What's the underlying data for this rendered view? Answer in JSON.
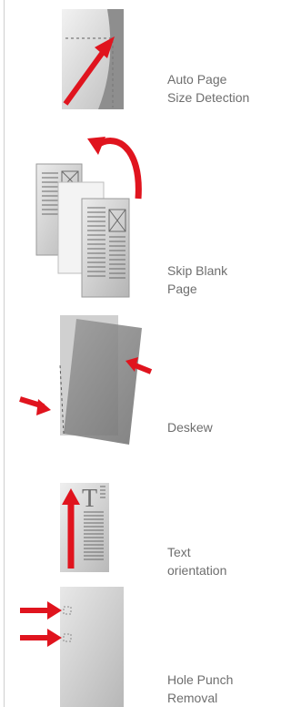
{
  "features": [
    {
      "line1": "Auto Page",
      "line2": "Size Detection",
      "icon": "auto-page-size-detection-icon"
    },
    {
      "line1": "Skip Blank",
      "line2": "Page",
      "icon": "skip-blank-page-icon"
    },
    {
      "line1": "Deskew",
      "line2": "",
      "icon": "deskew-icon"
    },
    {
      "line1": "Text",
      "line2": "orientation",
      "icon": "text-orientation-icon"
    },
    {
      "line1": "Hole Punch",
      "line2": "Removal",
      "icon": "hole-punch-removal-icon"
    }
  ],
  "colors": {
    "arrow": "#e0141e",
    "label": "#6e6e6e",
    "divider": "#cfcfcf"
  }
}
